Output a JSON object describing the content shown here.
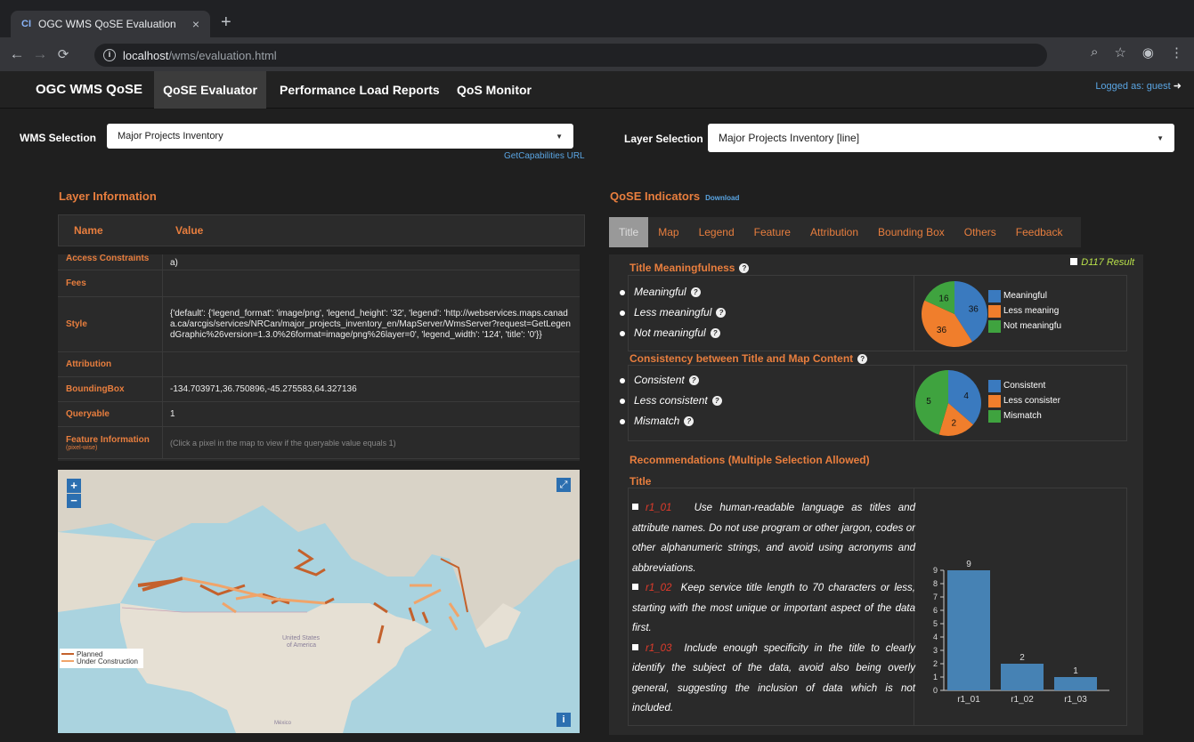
{
  "browser": {
    "tab_title": "OGC WMS QoSE Evaluation",
    "favicon": "CI",
    "url_host": "localhost",
    "url_path": "/wms/evaluation.html"
  },
  "nav": {
    "brand": "OGC WMS QoSE",
    "items": [
      "QoSE Evaluator",
      "Performance Load Reports",
      "QoS Monitor"
    ],
    "logged_as": "Logged as: guest"
  },
  "wms_selection": {
    "label": "WMS Selection",
    "value": "Major Projects Inventory",
    "link": "GetCapabilities URL"
  },
  "layer_selection": {
    "label": "Layer Selection",
    "value": "Major Projects Inventory [line]"
  },
  "layer_info": {
    "title": "Layer Information",
    "col_name": "Name",
    "col_value": "Value",
    "rows": [
      {
        "k": "Access Constraints",
        "v": "a)"
      },
      {
        "k": "Fees",
        "v": ""
      },
      {
        "k": "Style",
        "v": "{'default': {'legend_format': 'image/png', 'legend_height': '32', 'legend': 'http://webservices.maps.canada.ca/arcgis/services/NRCan/major_projects_inventory_en/MapServer/WmsServer?request=GetLegendGraphic%26version=1.3.0%26format=image/png%26layer=0', 'legend_width': '124', 'title': '0'}}"
      },
      {
        "k": "Attribution",
        "v": ""
      },
      {
        "k": "BoundingBox",
        "v": "-134.703971,36.750896,-45.275583,64.327136"
      },
      {
        "k": "Queryable",
        "v": "1"
      },
      {
        "k": "Feature Information",
        "sub": "(pixel-wise)",
        "v": "(Click a pixel in the map to view if the queryable value equals 1)"
      }
    ]
  },
  "map": {
    "label_us": "United States",
    "label_us2": "of America",
    "label_mx": "México",
    "legend": [
      "Planned",
      "Under Construction"
    ],
    "colors": {
      "planned": "#c4612c",
      "construction": "#f0a46a"
    }
  },
  "qose": {
    "title": "QoSE Indicators",
    "download": "Download",
    "tabs": [
      "Title",
      "Map",
      "Legend",
      "Feature",
      "Attribution",
      "Bounding Box",
      "Others",
      "Feedback"
    ],
    "d117": "D117 Result",
    "meaningfulness": {
      "title": "Title Meaningfulness",
      "options": [
        "Meaningful",
        "Less meaningful",
        "Not meaningful"
      ],
      "legend": [
        "Meaningful",
        "Less meaning",
        "Not meaningfu"
      ]
    },
    "consistency": {
      "title": "Consistency between Title and Map Content",
      "options": [
        "Consistent",
        "Less consistent",
        "Mismatch"
      ],
      "legend": [
        "Consistent",
        "Less consister",
        "Mismatch"
      ]
    },
    "rec_title": "Recommendations (Multiple Selection Allowed)",
    "rec_sub": "Title",
    "recommendations": [
      {
        "code": "r1_01",
        "text": "Use human-readable language as titles and attribute names. Do not use program or other jargon, codes or other alphanumeric strings, and avoid using acronyms and abbreviations."
      },
      {
        "code": "r1_02",
        "text": "Keep service title length to 70 characters or less, starting with the most unique or important aspect of the data first."
      },
      {
        "code": "r1_03",
        "text": "Include enough specificity in the title to clearly identify the subject of the data, avoid also being overly general, suggesting the inclusion of data which is not included."
      }
    ]
  },
  "chart_data": [
    {
      "type": "pie",
      "categories": [
        "Meaningful",
        "Less meaningful",
        "Not meaningful"
      ],
      "values": [
        36,
        36,
        16
      ],
      "colors": [
        "#3a7abf",
        "#f07e2c",
        "#3fa33f"
      ]
    },
    {
      "type": "pie",
      "categories": [
        "Consistent",
        "Less consistent",
        "Mismatch"
      ],
      "values": [
        4,
        2,
        5
      ],
      "colors": [
        "#3a7abf",
        "#f07e2c",
        "#3fa33f"
      ]
    },
    {
      "type": "bar",
      "categories": [
        "r1_01",
        "r1_02",
        "r1_03"
      ],
      "values": [
        9,
        2,
        1
      ],
      "ylim": [
        0,
        9
      ],
      "yticks": [
        0,
        1,
        2,
        3,
        4,
        5,
        6,
        7,
        8,
        9
      ],
      "color": "#4682b4"
    }
  ]
}
